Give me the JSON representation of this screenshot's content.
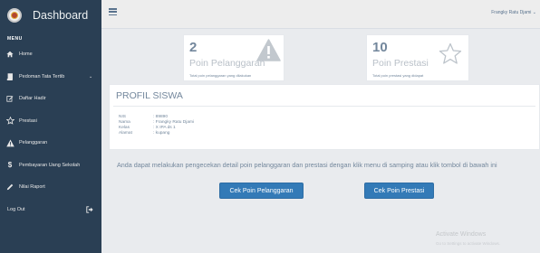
{
  "brand": {
    "title": "Dashboard"
  },
  "sidebar": {
    "section_label": "MENU",
    "items": [
      {
        "label": "Home",
        "icon": "home-icon"
      },
      {
        "label": "Pedoman Tata Tertib",
        "icon": "book-icon",
        "has_chevron": true
      },
      {
        "label": "Daftar Hadir",
        "icon": "edit-icon"
      },
      {
        "label": "Prestasi",
        "icon": "star-icon"
      },
      {
        "label": "Pelanggaran",
        "icon": "warning-icon"
      },
      {
        "label": "Pembayaran Uang Sekolah",
        "icon": "dollar-icon"
      },
      {
        "label": "Nilai Raport",
        "icon": "pencil-icon"
      },
      {
        "label": "Log Out",
        "icon": "logout-icon"
      }
    ]
  },
  "topbar": {
    "user_name": "Frangky Ratu Djami"
  },
  "cards": {
    "pelanggaran": {
      "count": "2",
      "label": "Poin Pelanggaran",
      "sub": "Total poin pelanggaran yang dilakukan",
      "icon": "warning-icon"
    },
    "prestasi": {
      "count": "10",
      "label": "Poin Prestasi",
      "sub": "Total poin prestasi yang didapat",
      "icon": "star-outline-icon"
    }
  },
  "profile": {
    "title": "PROFIL SISWA",
    "fields": [
      {
        "key": "NIS",
        "value": ": 89890"
      },
      {
        "key": "Nama",
        "value": ": Frangky Ratu Djami"
      },
      {
        "key": "Kelas",
        "value": ": X IPA ds 1"
      },
      {
        "key": "Alamat",
        "value": ": kupang"
      }
    ]
  },
  "info_text": "Anda dapat melakukan pengecekan detail poin pelanggaran dan prestasi dengan klik menu di samping atau klik tombol di bawah ini",
  "buttons": {
    "cek_pelanggaran": "Cek Poin Pelanggaran",
    "cek_prestasi": "Cek Poin Prestasi"
  },
  "watermark": {
    "line1": "Activate Windows",
    "line2": "Go to Settings to activate Windows."
  },
  "colors": {
    "sidebar": "#2a3f54",
    "button": "#337ab7",
    "text_muted": "#73879c"
  }
}
